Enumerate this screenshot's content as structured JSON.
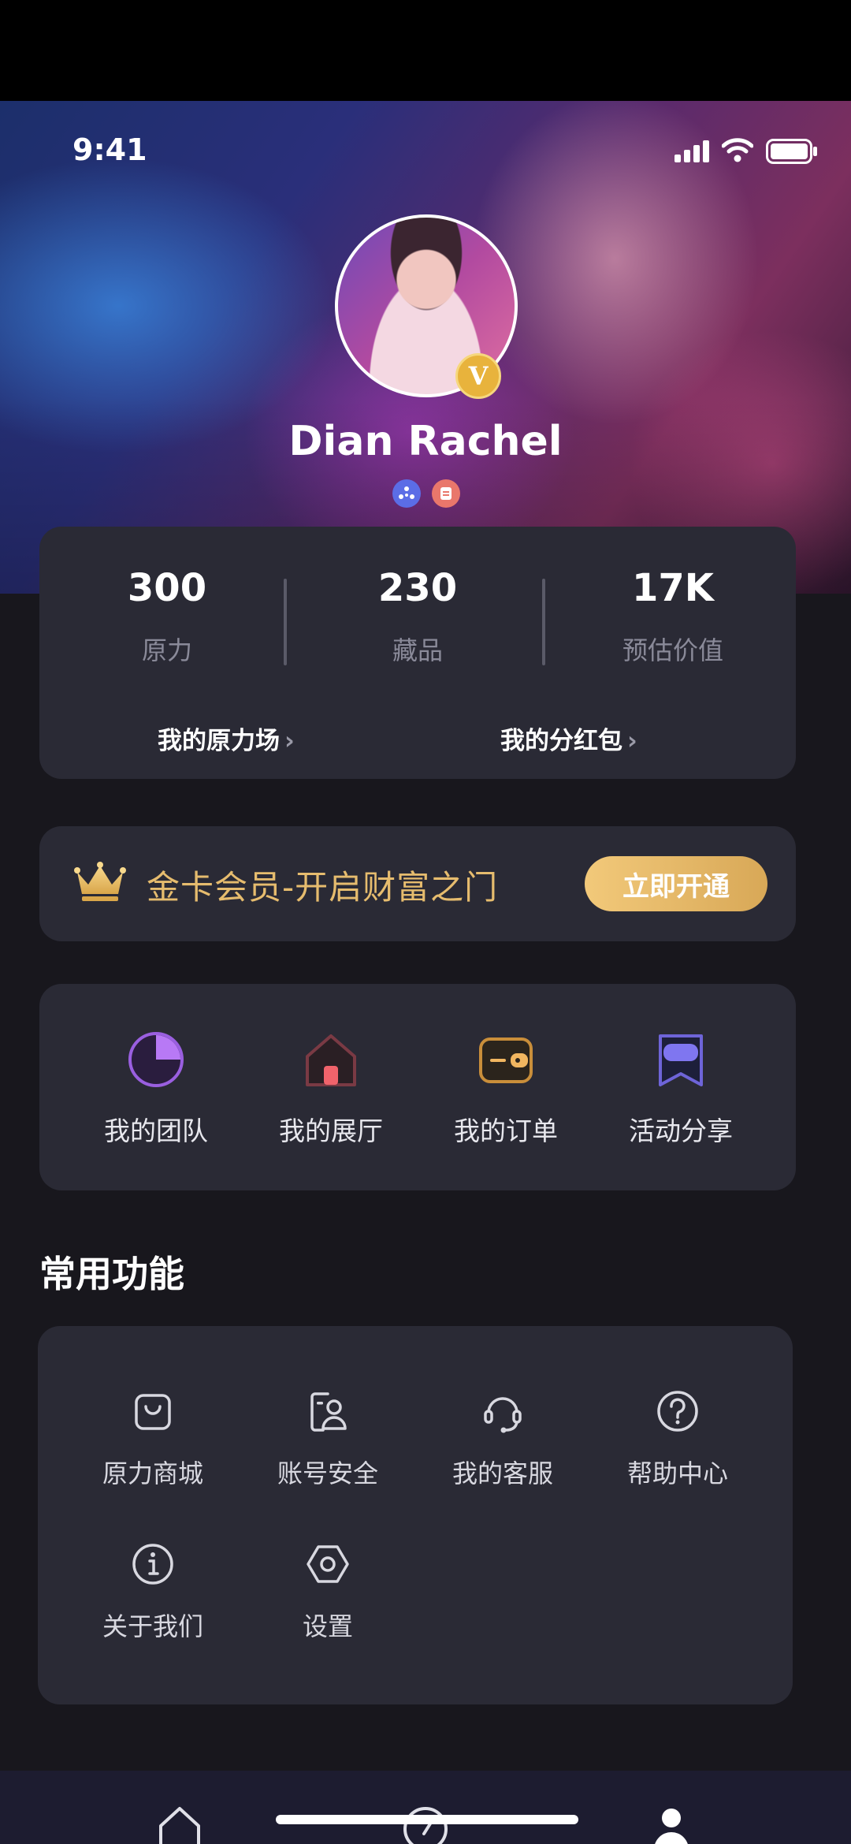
{
  "status_bar": {
    "time": "9:41"
  },
  "profile": {
    "name": "Dian Rachel",
    "vip_letter": "V"
  },
  "stats": {
    "items": [
      {
        "value": "300",
        "label": "原力"
      },
      {
        "value": "230",
        "label": "藏品"
      },
      {
        "value": "17K",
        "label": "预估价值"
      }
    ],
    "links": [
      {
        "label": "我的原力场",
        "chevron": "›"
      },
      {
        "label": "我的分红包",
        "chevron": "›"
      }
    ]
  },
  "vip": {
    "text": "金卡会员-开启财富之门",
    "button": "立即开通"
  },
  "quick": {
    "items": [
      {
        "label": "我的团队",
        "icon": "pie-chart-icon"
      },
      {
        "label": "我的展厅",
        "icon": "house-icon"
      },
      {
        "label": "我的订单",
        "icon": "wallet-icon"
      },
      {
        "label": "活动分享",
        "icon": "share-flag-icon"
      }
    ]
  },
  "functions": {
    "title": "常用功能",
    "items": [
      {
        "label": "原力商城",
        "icon": "shopping-bag-icon"
      },
      {
        "label": "账号安全",
        "icon": "account-security-icon"
      },
      {
        "label": "我的客服",
        "icon": "headset-icon"
      },
      {
        "label": "帮助中心",
        "icon": "help-icon"
      },
      {
        "label": "关于我们",
        "icon": "info-icon"
      },
      {
        "label": "设置",
        "icon": "settings-icon"
      }
    ]
  },
  "colors": {
    "background": "#18171d",
    "card": "#2a2a35",
    "gold": "#e6bc6e",
    "accent_purple": "#b36bf0",
    "muted": "#8a8a99"
  }
}
